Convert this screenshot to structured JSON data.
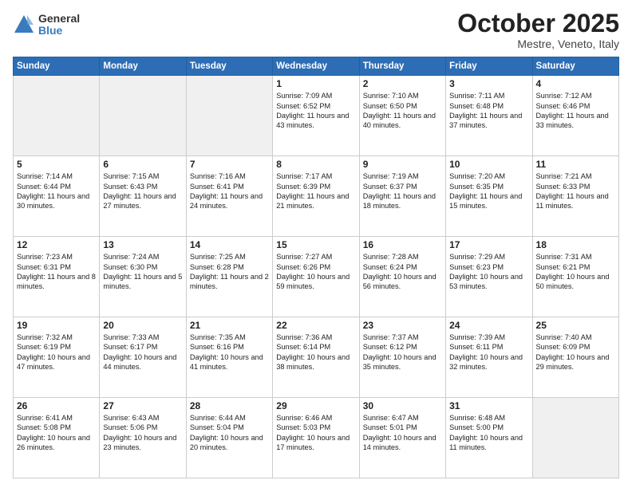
{
  "logo": {
    "general": "General",
    "blue": "Blue"
  },
  "header": {
    "month": "October 2025",
    "location": "Mestre, Veneto, Italy"
  },
  "weekdays": [
    "Sunday",
    "Monday",
    "Tuesday",
    "Wednesday",
    "Thursday",
    "Friday",
    "Saturday"
  ],
  "weeks": [
    [
      {
        "day": "",
        "empty": true
      },
      {
        "day": "",
        "empty": true
      },
      {
        "day": "",
        "empty": true
      },
      {
        "day": "1",
        "sunrise": "7:09 AM",
        "sunset": "6:52 PM",
        "daylight": "11 hours and 43 minutes."
      },
      {
        "day": "2",
        "sunrise": "7:10 AM",
        "sunset": "6:50 PM",
        "daylight": "11 hours and 40 minutes."
      },
      {
        "day": "3",
        "sunrise": "7:11 AM",
        "sunset": "6:48 PM",
        "daylight": "11 hours and 37 minutes."
      },
      {
        "day": "4",
        "sunrise": "7:12 AM",
        "sunset": "6:46 PM",
        "daylight": "11 hours and 33 minutes."
      }
    ],
    [
      {
        "day": "5",
        "sunrise": "7:14 AM",
        "sunset": "6:44 PM",
        "daylight": "11 hours and 30 minutes."
      },
      {
        "day": "6",
        "sunrise": "7:15 AM",
        "sunset": "6:43 PM",
        "daylight": "11 hours and 27 minutes."
      },
      {
        "day": "7",
        "sunrise": "7:16 AM",
        "sunset": "6:41 PM",
        "daylight": "11 hours and 24 minutes."
      },
      {
        "day": "8",
        "sunrise": "7:17 AM",
        "sunset": "6:39 PM",
        "daylight": "11 hours and 21 minutes."
      },
      {
        "day": "9",
        "sunrise": "7:19 AM",
        "sunset": "6:37 PM",
        "daylight": "11 hours and 18 minutes."
      },
      {
        "day": "10",
        "sunrise": "7:20 AM",
        "sunset": "6:35 PM",
        "daylight": "11 hours and 15 minutes."
      },
      {
        "day": "11",
        "sunrise": "7:21 AM",
        "sunset": "6:33 PM",
        "daylight": "11 hours and 11 minutes."
      }
    ],
    [
      {
        "day": "12",
        "sunrise": "7:23 AM",
        "sunset": "6:31 PM",
        "daylight": "11 hours and 8 minutes."
      },
      {
        "day": "13",
        "sunrise": "7:24 AM",
        "sunset": "6:30 PM",
        "daylight": "11 hours and 5 minutes."
      },
      {
        "day": "14",
        "sunrise": "7:25 AM",
        "sunset": "6:28 PM",
        "daylight": "11 hours and 2 minutes."
      },
      {
        "day": "15",
        "sunrise": "7:27 AM",
        "sunset": "6:26 PM",
        "daylight": "10 hours and 59 minutes."
      },
      {
        "day": "16",
        "sunrise": "7:28 AM",
        "sunset": "6:24 PM",
        "daylight": "10 hours and 56 minutes."
      },
      {
        "day": "17",
        "sunrise": "7:29 AM",
        "sunset": "6:23 PM",
        "daylight": "10 hours and 53 minutes."
      },
      {
        "day": "18",
        "sunrise": "7:31 AM",
        "sunset": "6:21 PM",
        "daylight": "10 hours and 50 minutes."
      }
    ],
    [
      {
        "day": "19",
        "sunrise": "7:32 AM",
        "sunset": "6:19 PM",
        "daylight": "10 hours and 47 minutes."
      },
      {
        "day": "20",
        "sunrise": "7:33 AM",
        "sunset": "6:17 PM",
        "daylight": "10 hours and 44 minutes."
      },
      {
        "day": "21",
        "sunrise": "7:35 AM",
        "sunset": "6:16 PM",
        "daylight": "10 hours and 41 minutes."
      },
      {
        "day": "22",
        "sunrise": "7:36 AM",
        "sunset": "6:14 PM",
        "daylight": "10 hours and 38 minutes."
      },
      {
        "day": "23",
        "sunrise": "7:37 AM",
        "sunset": "6:12 PM",
        "daylight": "10 hours and 35 minutes."
      },
      {
        "day": "24",
        "sunrise": "7:39 AM",
        "sunset": "6:11 PM",
        "daylight": "10 hours and 32 minutes."
      },
      {
        "day": "25",
        "sunrise": "7:40 AM",
        "sunset": "6:09 PM",
        "daylight": "10 hours and 29 minutes."
      }
    ],
    [
      {
        "day": "26",
        "sunrise": "6:41 AM",
        "sunset": "5:08 PM",
        "daylight": "10 hours and 26 minutes."
      },
      {
        "day": "27",
        "sunrise": "6:43 AM",
        "sunset": "5:06 PM",
        "daylight": "10 hours and 23 minutes."
      },
      {
        "day": "28",
        "sunrise": "6:44 AM",
        "sunset": "5:04 PM",
        "daylight": "10 hours and 20 minutes."
      },
      {
        "day": "29",
        "sunrise": "6:46 AM",
        "sunset": "5:03 PM",
        "daylight": "10 hours and 17 minutes."
      },
      {
        "day": "30",
        "sunrise": "6:47 AM",
        "sunset": "5:01 PM",
        "daylight": "10 hours and 14 minutes."
      },
      {
        "day": "31",
        "sunrise": "6:48 AM",
        "sunset": "5:00 PM",
        "daylight": "10 hours and 11 minutes."
      },
      {
        "day": "",
        "empty": true
      }
    ]
  ]
}
